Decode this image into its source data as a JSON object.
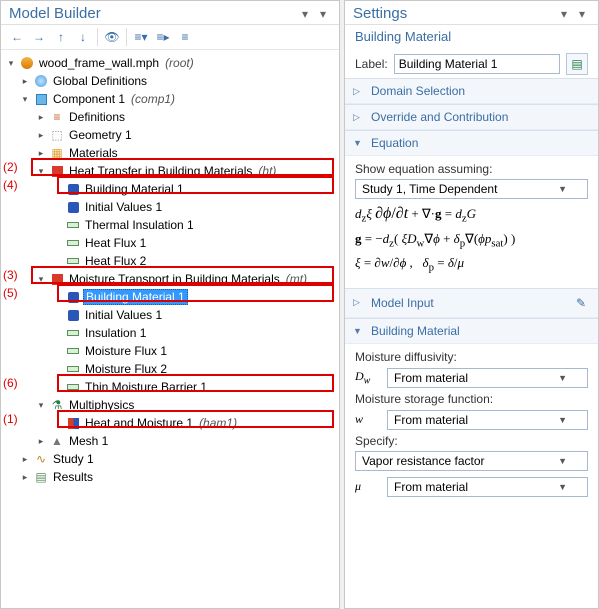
{
  "panels": {
    "model_builder_title": "Model Builder",
    "settings_title": "Settings"
  },
  "tree": {
    "root": "wood_frame_wall.mph",
    "root_hint": "(root)",
    "global_defs": "Global Definitions",
    "component": "Component 1",
    "component_hint": "(comp1)",
    "definitions": "Definitions",
    "geometry": "Geometry 1",
    "materials": "Materials",
    "ht_physics": "Heat Transfer in Building Materials",
    "ht_hint": "(ht)",
    "ht_bm1": "Building Material 1",
    "ht_iv1": "Initial Values 1",
    "ht_ti1": "Thermal Insulation 1",
    "ht_hf1": "Heat Flux 1",
    "ht_hf2": "Heat Flux 2",
    "mt_physics": "Moisture Transport in Building Materials",
    "mt_hint": "(mt)",
    "mt_bm1": "Building Material 1",
    "mt_iv1": "Initial Values 1",
    "mt_ins1": "Insulation 1",
    "mt_mf1": "Moisture Flux 1",
    "mt_mf2": "Moisture Flux 2",
    "mt_tmb1": "Thin Moisture Barrier 1",
    "multiphysics": "Multiphysics",
    "ham1": "Heat and Moisture 1",
    "ham1_hint": "(ham1)",
    "mesh": "Mesh 1",
    "study": "Study 1",
    "results": "Results"
  },
  "annotations": {
    "n1": "(1)",
    "n2": "(2)",
    "n3": "(3)",
    "n4": "(4)",
    "n5": "(5)",
    "n6": "(6)"
  },
  "settings": {
    "subtitle": "Building Material",
    "label_text": "Label:",
    "label_value": "Building Material 1",
    "sections": {
      "domain_selection": "Domain Selection",
      "override": "Override and Contribution",
      "equation": "Equation",
      "model_input": "Model Input",
      "building_material": "Building Material"
    },
    "equation": {
      "assume_label": "Show equation assuming:",
      "assume_value": "Study 1, Time Dependent",
      "eq1": "d_z ξ (∂ϕ/∂t) + ∇·g = d_z G",
      "eq2": "g = −d_z ( ξ D_w ∇ϕ + δ_p ∇(ϕ p_sat) )",
      "eq3": "ξ = ∂w/∂ϕ ,   δ_p = δ/μ"
    },
    "building_material": {
      "md_label": "Moisture diffusivity:",
      "md_sym": "D_w",
      "md_val": "From material",
      "msf_label": "Moisture storage function:",
      "msf_sym": "w",
      "msf_val": "From material",
      "specify_label": "Specify:",
      "specify_val": "Vapor resistance factor",
      "mu_sym": "μ",
      "mu_val": "From material"
    }
  }
}
